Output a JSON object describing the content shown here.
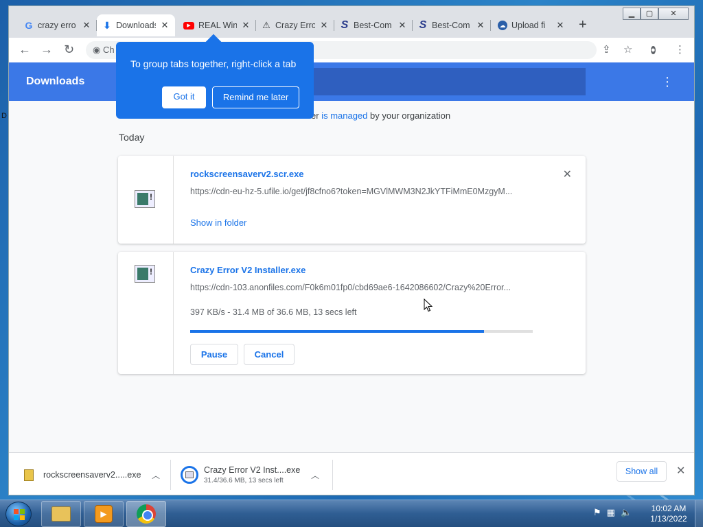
{
  "tabs": [
    {
      "title": "crazy erro",
      "icon": "google-icon"
    },
    {
      "title": "Downloads",
      "icon": "download-icon",
      "active": true
    },
    {
      "title": "REAL Win",
      "icon": "youtube-icon"
    },
    {
      "title": "Crazy Erro",
      "icon": "triangle-icon"
    },
    {
      "title": "Best-Com",
      "icon": "brand-s-icon"
    },
    {
      "title": "Best-Com",
      "icon": "brand-s-icon"
    },
    {
      "title": "Upload fi",
      "icon": "upload-icon"
    }
  ],
  "toolbar": {
    "address_fragment": "Ch"
  },
  "page": {
    "title": "Downloads",
    "managed_text": "er",
    "managed_link": "is managed",
    "managed_suffix": "by your organization",
    "section": "Today"
  },
  "tooltip": {
    "message": "To group tabs together, right-click a tab",
    "got_it": "Got it",
    "remind": "Remind me later"
  },
  "downloads": [
    {
      "name": "rockscreensaverv2.scr.exe",
      "url": "https://cdn-eu-hz-5.ufile.io/get/jf8cfno6?token=MGVlMWM3N2JkYTFiMmE0MzgyM...",
      "action": "Show in folder"
    },
    {
      "name": "Crazy Error V2 Installer.exe",
      "url": "https://cdn-103.anonfiles.com/F0k6m01fp0/cbd69ae6-1642086602/Crazy%20Error...",
      "status": "397 KB/s - 31.4 MB of 36.6 MB, 13 secs left",
      "progress": 0.858,
      "pause": "Pause",
      "cancel": "Cancel"
    }
  ],
  "shelf": {
    "item1": "rockscreensaverv2.....exe",
    "item2": "Crazy Error V2 Inst....exe",
    "item2_sub": "31.4/36.6 MB, 13 secs left",
    "show_all": "Show all"
  },
  "desktop": {
    "icon_letter": "D"
  },
  "taskbar": {
    "time": "10:02 AM",
    "date": "1/13/2022"
  }
}
